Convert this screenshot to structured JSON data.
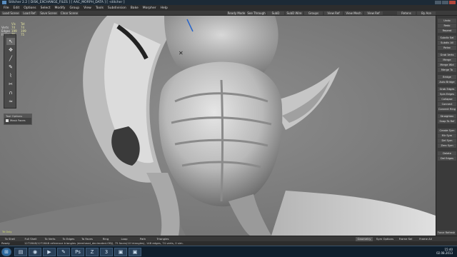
{
  "window": {
    "title": "Stitcher 2.2 [ DISK_EXCHANGE_FILES ] [ AAC_MORPH_DATA ] [ -stitcher ]"
  },
  "menu": [
    "File",
    "Edit",
    "Options",
    "Select",
    "Modify",
    "Group",
    "View",
    "Tools",
    "Subdivision",
    "Bake",
    "Morpher",
    "Help"
  ],
  "toolbar": {
    "left": [
      "Load Scene",
      "Load Ref",
      "Save Scene",
      "Clear Scene"
    ],
    "right": [
      "Ready Mode",
      "See Through",
      "SubD",
      "SubD Wire",
      "Groups",
      "View Ref",
      "View Mesh",
      "View Ref",
      "Retens",
      "By Ace"
    ]
  },
  "stats": {
    "header": [
      "",
      "Vis",
      "Tot"
    ],
    "rows": [
      {
        "label": "Verts",
        "vis": "74",
        "tot": "74"
      },
      {
        "label": "Edges",
        "vis": "199",
        "tot": "199"
      },
      {
        "label": "Faces",
        "vis": "75",
        "tot": "75"
      }
    ]
  },
  "tools": [
    "select-arrow",
    "move",
    "brush",
    "pencil",
    "knife",
    "cut",
    "magnet",
    "smooth"
  ],
  "tool_options": {
    "header": "Tool Options",
    "option_label": "Mask Faces"
  },
  "right_panel": [
    "Undo",
    "Redo",
    "Repeat",
    "Subdiv Sel",
    "Subdiv All",
    "Relax",
    "Grab Verts",
    "Merge",
    "Merge Wld",
    "Merge To",
    "Bridge",
    "Auto Bridge",
    "Grab Edges",
    "Spin Edges",
    "Collapse",
    "Connect",
    "Connect Ring",
    "Straighten",
    "Snap To Ref",
    "Create Sym",
    "Mir Sym",
    "Del Sym",
    "Zero Sym",
    "Delete",
    "Del Edges"
  ],
  "bottom_left_label": "Tri Only",
  "bottom": {
    "left": [
      "To Shell",
      "Full Shell",
      "To Verts",
      "To Edges",
      "To Faces",
      "Ring",
      "Loop",
      "Path",
      "Triangles"
    ],
    "right": [
      "Geometry",
      "Sym Options",
      "Frame Sel",
      "Frame All"
    ],
    "panel_button": "Force Refresh"
  },
  "status": {
    "mode": "Ready",
    "message": "1272848/1272848 reference triangles (demhead_decimated.OBJ), 75 faces(10 triangles), 148 edges, 74 verts, 0 sim."
  },
  "taskbar": {
    "time": "15:40",
    "date": "02.08.2013"
  },
  "icons": {
    "start": "windows-start-icon",
    "apps": [
      "folder-icon",
      "browser-icon",
      "media-icon",
      "paint-icon",
      "photoshop-icon",
      "zbrush-icon",
      "3dsmax-icon",
      "app-icon",
      "app-icon"
    ]
  }
}
